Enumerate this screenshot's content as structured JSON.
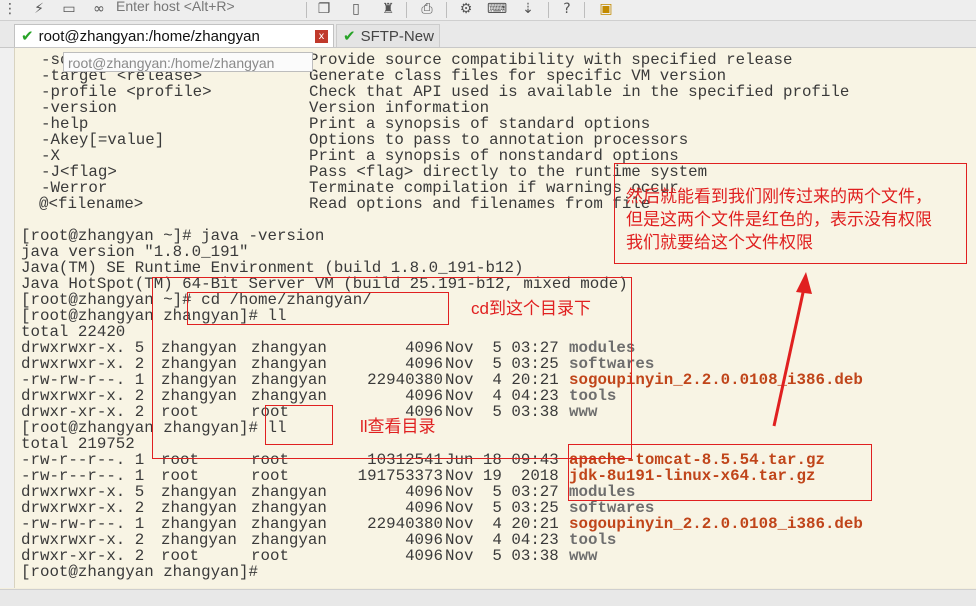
{
  "toolbar": {
    "host_placeholder": "Enter host <Alt+R>",
    "icons": [
      "terminal-icon",
      "flash-icon",
      "window-icon",
      "link-icon",
      "copy-icon",
      "paste-icon",
      "find-icon",
      "print-icon",
      "settings-icon",
      "keymap-icon",
      "sftp-icon",
      "help-icon",
      "lock-icon"
    ]
  },
  "tabs": [
    {
      "label": "root@zhangyan:/home/zhangyan",
      "active": true
    },
    {
      "label": "SFTP-New",
      "active": false
    }
  ],
  "tab_close_glyph": "x",
  "tooltip": "root@zhangyan:/home/zhangyan",
  "options": [
    {
      "opt": "-source <release>",
      "desc": "Provide source compatibility with specified release"
    },
    {
      "opt": "-target <release>",
      "desc": "Generate class files for specific VM version"
    },
    {
      "opt": "-profile <profile>",
      "desc": "Check that API used is available in the specified profile"
    },
    {
      "opt": "-version",
      "desc": "Version information"
    },
    {
      "opt": "-help",
      "desc": "Print a synopsis of standard options"
    },
    {
      "opt": "-Akey[=value]",
      "desc": "Options to pass to annotation processors"
    },
    {
      "opt": "-X",
      "desc": "Print a synopsis of nonstandard options"
    },
    {
      "opt": "-J<flag>",
      "desc": "Pass <flag> directly to the runtime system"
    },
    {
      "opt": "-Werror",
      "desc": "Terminate compilation if warnings occur"
    },
    {
      "opt": "@<filename>",
      "desc": "Read options and filenames from file"
    }
  ],
  "text_lines": [
    "[root@zhangyan ~]# java -version",
    "java version \"1.8.0_191\"",
    "Java(TM) SE Runtime Environment (build 1.8.0_191-b12)",
    "Java HotSpot(TM) 64-Bit Server VM (build 25.191-b12, mixed mode)",
    "[root@zhangyan ~]# cd /home/zhangyan/",
    "[root@zhangyan zhangyan]# ll",
    "total 22420"
  ],
  "listing1": [
    {
      "perm": "drwxrwxr-x. 5",
      "owner": "zhangyan",
      "group": "zhangyan",
      "size": "4096",
      "date": "Nov  5 03:27",
      "name": "modules",
      "style": "dir"
    },
    {
      "perm": "drwxrwxr-x. 2",
      "owner": "zhangyan",
      "group": "zhangyan",
      "size": "4096",
      "date": "Nov  5 03:25",
      "name": "softwares",
      "style": "dir"
    },
    {
      "perm": "-rw-rw-r--. 1",
      "owner": "zhangyan",
      "group": "zhangyan",
      "size": "22940380",
      "date": "Nov  4 20:21",
      "name": "sogoupinyin_2.2.0.0108_i386.deb",
      "style": "red"
    },
    {
      "perm": "drwxrwxr-x. 2",
      "owner": "zhangyan",
      "group": "zhangyan",
      "size": "4096",
      "date": "Nov  4 04:23",
      "name": "tools",
      "style": "dir"
    },
    {
      "perm": "drwxr-xr-x. 2",
      "owner": "root",
      "group": "root",
      "size": "4096",
      "date": "Nov  5 03:38",
      "name": "www",
      "style": "dir"
    }
  ],
  "prompt_ll": "[root@zhangyan zhangyan]# ll",
  "total2": "total 219752",
  "listing2": [
    {
      "perm": "-rw-r--r--. 1",
      "owner": "root",
      "group": "root",
      "size": "10312541",
      "date": "Jun 18 09:43",
      "name": "apache-tomcat-8.5.54.tar.gz",
      "style": "red"
    },
    {
      "perm": "-rw-r--r--. 1",
      "owner": "root",
      "group": "root",
      "size": "191753373",
      "date": "Nov 19  2018",
      "name": "jdk-8u191-linux-x64.tar.gz",
      "style": "red"
    },
    {
      "perm": "drwxrwxr-x. 5",
      "owner": "zhangyan",
      "group": "zhangyan",
      "size": "4096",
      "date": "Nov  5 03:27",
      "name": "modules",
      "style": "dir"
    },
    {
      "perm": "drwxrwxr-x. 2",
      "owner": "zhangyan",
      "group": "zhangyan",
      "size": "4096",
      "date": "Nov  5 03:25",
      "name": "softwares",
      "style": "dir"
    },
    {
      "perm": "-rw-rw-r--. 1",
      "owner": "zhangyan",
      "group": "zhangyan",
      "size": "22940380",
      "date": "Nov  4 20:21",
      "name": "sogoupinyin_2.2.0.0108_i386.deb",
      "style": "red"
    },
    {
      "perm": "drwxrwxr-x. 2",
      "owner": "zhangyan",
      "group": "zhangyan",
      "size": "4096",
      "date": "Nov  4 04:23",
      "name": "tools",
      "style": "dir"
    },
    {
      "perm": "drwxr-xr-x. 2",
      "owner": "root",
      "group": "root",
      "size": "4096",
      "date": "Nov  5 03:38",
      "name": "www",
      "style": "dir"
    }
  ],
  "final_prompt": "[root@zhangyan zhangyan]# ",
  "annotations": {
    "cd_note": "cd到这个目录下",
    "ll_note": "ll查看目录",
    "main_note": [
      "然后就能看到我们刚传过来的两个文件，",
      "但是这两个文件是红色的，表示没有权限",
      "我们就要给这个文件权限"
    ]
  },
  "colors": {
    "terminal_bg": "#f8f4e4",
    "dir_name": "#6e6e6e",
    "file_red": "#c0451a",
    "annotation_red": "#e02020",
    "tab_check": "#27a327"
  }
}
